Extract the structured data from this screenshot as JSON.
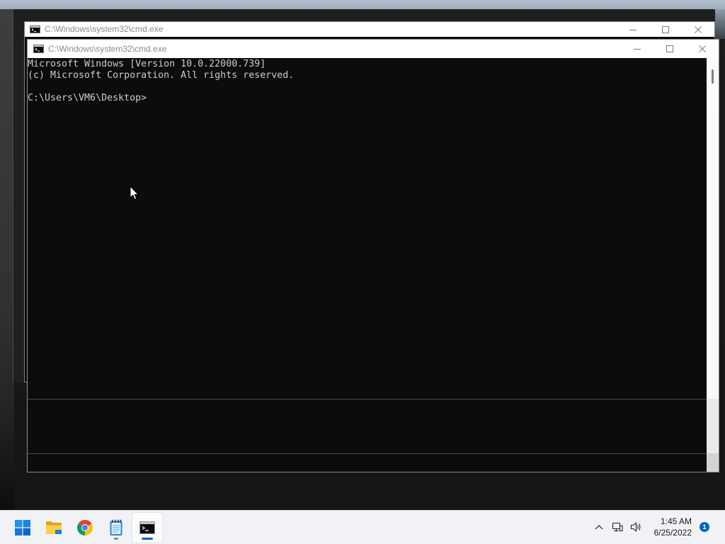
{
  "desktop": {
    "windows": {
      "back": {
        "title": "C:\\Windows\\system32\\cmd.exe",
        "icon": "cmd-icon",
        "title_buttons": [
          "minimize-icon",
          "maximize-icon",
          "close-icon"
        ]
      },
      "front": {
        "title": "C:\\Windows\\system32\\cmd.exe",
        "icon": "cmd-icon",
        "title_buttons": [
          "minimize-icon",
          "maximize-icon",
          "close-icon"
        ],
        "console_lines": [
          "Microsoft Windows [Version 10.0.22000.739]",
          "(c) Microsoft Corporation. All rights reserved.",
          "",
          "C:\\Users\\VM6\\Desktop>"
        ]
      }
    },
    "cursor": "mouse-cursor-icon"
  },
  "taskbar": {
    "items": [
      {
        "icon": "windows-start-icon",
        "running": false,
        "active": false
      },
      {
        "icon": "file-explorer-icon",
        "running": false,
        "active": false
      },
      {
        "icon": "chrome-icon",
        "running": false,
        "active": false
      },
      {
        "icon": "notepad-icon",
        "running": true,
        "active": false
      },
      {
        "icon": "command-prompt-icon",
        "running": true,
        "active": true
      }
    ],
    "tray": {
      "icons": [
        "chevron-up-icon",
        "network-icon",
        "volume-icon"
      ],
      "time": "1:45 AM",
      "date": "6/25/2022",
      "notification_count": "1"
    }
  },
  "colors": {
    "accent": "#0067c0",
    "console_background": "#0c0c0c",
    "console_text": "#cccccc",
    "title_text": "#8a8a8a",
    "taskbar_background": "#f1f2f5"
  }
}
